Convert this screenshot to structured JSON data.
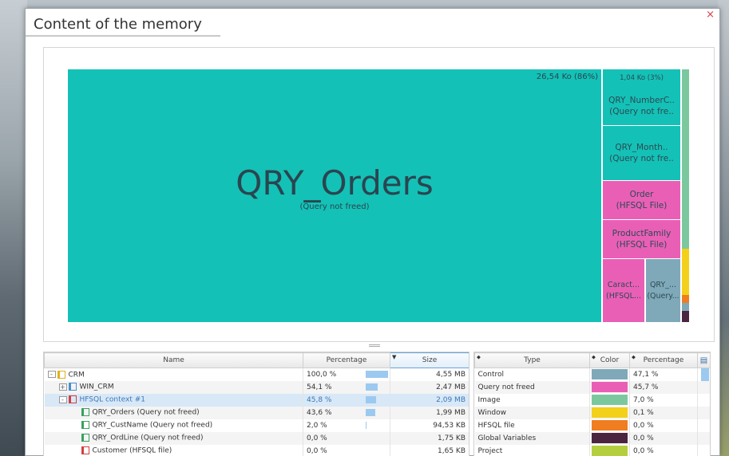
{
  "dialog": {
    "title": "Content of the memory",
    "close_glyph": "×"
  },
  "treemap": {
    "main": {
      "name": "QRY_Orders",
      "note": "(Query not freed)",
      "size": "26,54 Ko (86%)",
      "color": "#14c1b6"
    },
    "top_right_size": "1,04 Ko (3%)",
    "cells": [
      {
        "line1": "QRY_NumberC..",
        "line2": "(Query not fre..",
        "color": "#14c1b6"
      },
      {
        "line1": "QRY_Month..",
        "line2": "(Query not fre..",
        "color": "#14c1b6"
      },
      {
        "line1": "Order",
        "line2": "(HFSQL File)",
        "color": "#ea5fb6"
      },
      {
        "line1": "ProductFamily",
        "line2": "(HFSQL File)",
        "color": "#ea5fb6"
      },
      {
        "line1": "Caract...",
        "line2": "(HFSQL...",
        "color": "#ea5fb6"
      },
      {
        "line1": "QRY_...",
        "line2": "(Query...",
        "color": "#7fa9b9"
      }
    ]
  },
  "left_table": {
    "columns": {
      "name": "Name",
      "percentage": "Percentage",
      "size": "Size"
    },
    "rows": [
      {
        "name": "CRM",
        "pct": "100,0 %",
        "pct_value": 100,
        "size": "4,55 MB",
        "indent": 0,
        "expander": "-",
        "icon": "project-icon"
      },
      {
        "name": "WIN_CRM",
        "pct": "54,1 %",
        "pct_value": 54.1,
        "size": "2,47 MB",
        "indent": 1,
        "expander": "+",
        "icon": "window-icon"
      },
      {
        "name": "HFSQL context #1",
        "pct": "45,8 %",
        "pct_value": 45.8,
        "size": "2,09 MB",
        "indent": 1,
        "expander": "-",
        "icon": "hfsql-context-icon",
        "selected": true
      },
      {
        "name": "QRY_Orders (Query not freed)",
        "pct": "43,6 %",
        "pct_value": 43.6,
        "size": "1,99 MB",
        "indent": 2,
        "expander": "",
        "icon": "query-icon"
      },
      {
        "name": "QRY_CustName (Query not freed)",
        "pct": "2,0 %",
        "pct_value": 2.0,
        "size": "94,53 KB",
        "indent": 2,
        "expander": "",
        "icon": "query-icon"
      },
      {
        "name": "QRY_OrdLine (Query not freed)",
        "pct": "0,0 %",
        "pct_value": 0,
        "size": "1,75 KB",
        "indent": 2,
        "expander": "",
        "icon": "query-icon"
      },
      {
        "name": "Customer (HFSQL file)",
        "pct": "0,0 %",
        "pct_value": 0,
        "size": "1,65 KB",
        "indent": 2,
        "expander": "",
        "icon": "file-icon"
      }
    ]
  },
  "right_table": {
    "columns": {
      "type": "Type",
      "color": "Color",
      "percentage": "Percentage"
    },
    "rows": [
      {
        "type": "Control",
        "color": "#7fa9b9",
        "pct": "47,1 %",
        "pct_value": 47.1
      },
      {
        "type": "Query not freed",
        "color": "#ea5fb6",
        "pct": "45,7 %",
        "pct_value": 45.7
      },
      {
        "type": "Image",
        "color": "#7cc89e",
        "pct": "7,0 %",
        "pct_value": 7
      },
      {
        "type": "Window",
        "color": "#f3d01a",
        "pct": "0,1 %",
        "pct_value": 0.1
      },
      {
        "type": "HFSQL file",
        "color": "#f07d1f",
        "pct": "0,0 %",
        "pct_value": 0
      },
      {
        "type": "Global Variables",
        "color": "#4b2440",
        "pct": "0,0 %",
        "pct_value": 0
      },
      {
        "type": "Project",
        "color": "#b3cf3d",
        "pct": "0,0 %",
        "pct_value": 0
      }
    ]
  }
}
